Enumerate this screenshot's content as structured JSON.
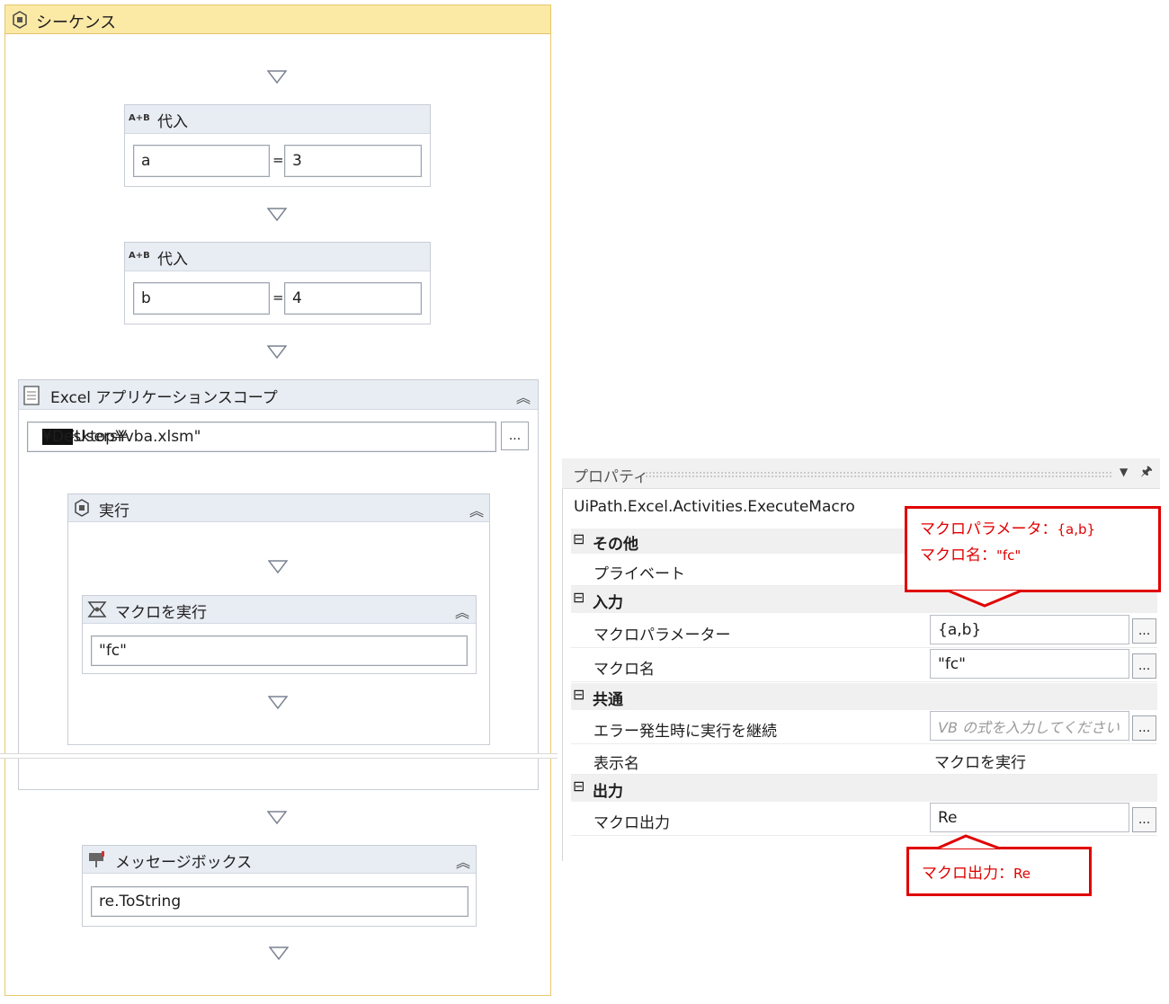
{
  "sequence": {
    "title": "シーケンス",
    "assign1": {
      "title": "代入",
      "icon_text": "A+B",
      "left": "a",
      "equals": "=",
      "right": "3"
    },
    "assign2": {
      "title": "代入",
      "icon_text": "A+B",
      "left": "b",
      "equals": "=",
      "right": "4"
    },
    "excel_scope": {
      "title": "Excel アプリケーションスコープ",
      "path_prefix": "\"C:¥Users¥",
      "path_suffix": "¥Desktop¥vba.xlsm\"",
      "browse_label": "...",
      "do": {
        "title": "実行",
        "execute_macro": {
          "title": "マクロを実行",
          "macro_name": "\"fc\""
        }
      }
    },
    "message_box": {
      "title": "メッセージボックス",
      "text": "re.ToString"
    }
  },
  "properties": {
    "title": "プロパティ",
    "type_name": "UiPath.Excel.Activities.ExecuteMacro",
    "cat_misc": "その他",
    "private_label": "プライベート",
    "cat_input": "入力",
    "macro_params_label": "マクロパラメーター",
    "macro_params_value": "{a,b}",
    "macro_name_label": "マクロ名",
    "macro_name_value": "\"fc\"",
    "cat_common": "共通",
    "continue_on_error_label": "エラー発生時に実行を継続",
    "continue_on_error_placeholder": "VB の式を入力してください",
    "display_name_label": "表示名",
    "display_name_value": "マクロを実行",
    "cat_output": "出力",
    "macro_output_label": "マクロ出力",
    "macro_output_value": "Re",
    "ellipsis": "...",
    "collapse_glyph": "⊟"
  },
  "callouts": {
    "params_line1_label": "マクロパラメータ：",
    "params_line1_value": "{a,b}",
    "params_line2_label": "マクロ名：",
    "params_line2_value": "\"fc\"",
    "output_label": "マクロ出力：",
    "output_value": "Re"
  },
  "colors": {
    "sequence_header": "#fbe9a6",
    "callout_border": "#e00000",
    "activity_header": "#e8ecf3"
  }
}
